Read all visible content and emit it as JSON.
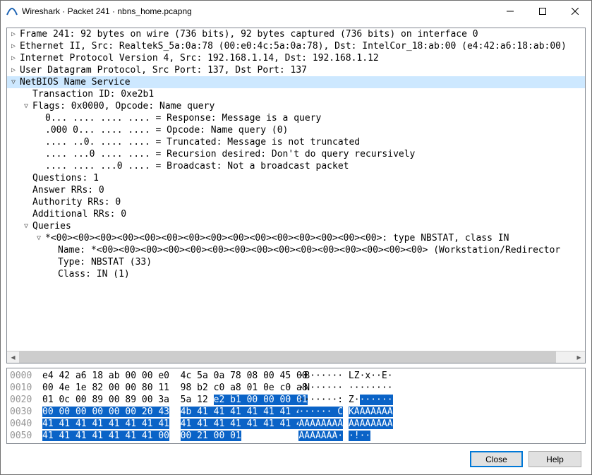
{
  "title": "Wireshark · Packet 241 · nbns_home.pcapng",
  "tree": {
    "frame": "Frame 241: 92 bytes on wire (736 bits), 92 bytes captured (736 bits) on interface 0",
    "eth": "Ethernet II, Src: RealtekS_5a:0a:78 (00:e0:4c:5a:0a:78), Dst: IntelCor_18:ab:00 (e4:42:a6:18:ab:00)",
    "ip": "Internet Protocol Version 4, Src: 192.168.1.14, Dst: 192.168.1.12",
    "udp": "User Datagram Protocol, Src Port: 137, Dst Port: 137",
    "nbns": "NetBIOS Name Service",
    "txid": "Transaction ID: 0xe2b1",
    "flags": "Flags: 0x0000, Opcode: Name query",
    "flag_resp": "0... .... .... .... = Response: Message is a query",
    "flag_op": ".000 0... .... .... = Opcode: Name query (0)",
    "flag_tr": ".... ..0. .... .... = Truncated: Message is not truncated",
    "flag_rd": ".... ...0 .... .... = Recursion desired: Don't do query recursively",
    "flag_bc": ".... .... ...0 .... = Broadcast: Not a broadcast packet",
    "qcount": "Questions: 1",
    "an": "Answer RRs: 0",
    "auth": "Authority RRs: 0",
    "add": "Additional RRs: 0",
    "queries": "Queries",
    "qentry": "*<00><00><00><00><00><00><00><00><00><00><00><00><00><00><00>: type NBSTAT, class IN",
    "qname": "Name: *<00><00><00><00><00><00><00><00><00><00><00><00><00><00><00> (Workstation/Redirector",
    "qtype": "Type: NBSTAT (33)",
    "qclass": "Class: IN (1)"
  },
  "hex": {
    "rows": [
      {
        "off": "0000",
        "b1": "e4 42 a6 18 ab 00 00 e0",
        "b2": "4c 5a 0a 78 08 00 45 00",
        "a1": "·B······",
        "a2": "LZ·x··E·",
        "h": -1
      },
      {
        "off": "0010",
        "b1": "00 4e 1e 82 00 00 80 11",
        "b2": "98 b2 c0 a8 01 0e c0 a8",
        "a1": "·N······",
        "a2": "········",
        "h": -1
      },
      {
        "off": "0020",
        "b1": "01 0c 00 89 00 89 00 3a",
        "b2": "5a 12 ",
        "b2h": "e2 b1 00 00 00 01",
        "a1": "·······:",
        "a2a": "Z·",
        "a2b": "······",
        "h": 2
      },
      {
        "off": "0030",
        "b1h": "00 00 00 00 00 00 20 43",
        "b2h": "4b 41 41 41 41 41 41 41",
        "a1h": "······ C",
        "a2h": "KAAAAAAA",
        "h": 3
      },
      {
        "off": "0040",
        "b1h": "41 41 41 41 41 41 41 41",
        "b2h": "41 41 41 41 41 41 41 41",
        "a1h": "AAAAAAAA",
        "a2h": "AAAAAAAA",
        "h": 3
      },
      {
        "off": "0050",
        "b1h": "41 41 41 41 41 41 41 00",
        "b2h": "00 21 00 01",
        "a1h": "AAAAAAA·",
        "a2h": "·!··",
        "h": 3
      }
    ]
  },
  "buttons": {
    "close": "Close",
    "help": "Help"
  }
}
